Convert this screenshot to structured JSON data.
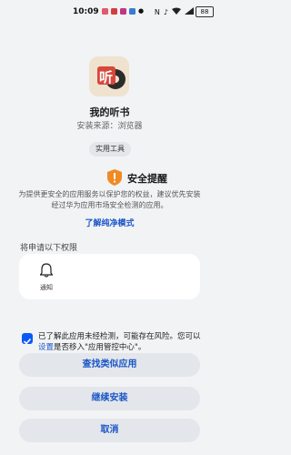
{
  "status": {
    "time": "10:09",
    "battery": "88",
    "colors": {
      "app1": "#e05a6b",
      "app2": "#d63c3c",
      "app3": "#c13584",
      "app4": "#3a7bd5"
    }
  },
  "app": {
    "name": "我的听书",
    "icon_char": "听",
    "source": "安装来源：浏览器",
    "tag": "实用工具"
  },
  "warning": {
    "title": "安全提醒",
    "description": "为提供更安全的应用服务以保护您的权益，建议优先安装经过华为应用市场安全检测的应用。",
    "link": "了解纯净模式"
  },
  "permissions": {
    "heading": "将申请以下权限",
    "items": [
      {
        "label": "通知",
        "icon": "bell-icon"
      }
    ]
  },
  "consent": {
    "checked": true,
    "text_before": "已了解此应用未经检测，可能存在风险。您可以",
    "link": "设置",
    "text_after": "是否移入\"应用管控中心\"。"
  },
  "buttons": {
    "find_similar": "查找类似应用",
    "continue": "继续安装",
    "cancel": "取消"
  },
  "colors": {
    "accent": "#0a59f7",
    "warning": "#f08a24",
    "link": "#1a56c8"
  }
}
